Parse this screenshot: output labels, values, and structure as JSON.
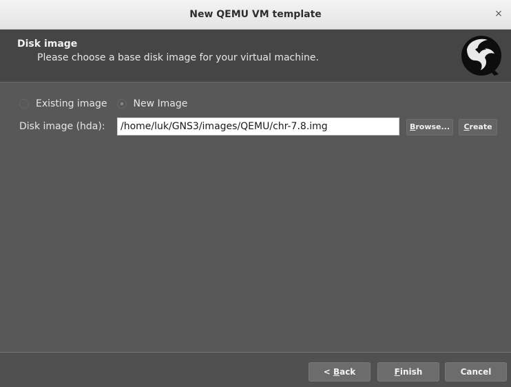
{
  "window": {
    "title": "New QEMU VM template",
    "close_glyph": "×"
  },
  "header": {
    "title": "Disk image",
    "subtitle": "Please choose a base disk image for your virtual machine.",
    "logo_icon": "qemu-logo"
  },
  "source": {
    "options": [
      {
        "label": "Existing image",
        "checked": false
      },
      {
        "label": "New Image",
        "checked": true
      }
    ]
  },
  "disk": {
    "label": "Disk image (hda):",
    "value": "/home/luk/GNS3/images/QEMU/chr-7.8.img",
    "browse_mnemonic": "B",
    "browse_rest": "rowse...",
    "create_mnemonic": "C",
    "create_rest": "reate"
  },
  "footer": {
    "back_prefix": "< ",
    "back_mnemonic": "B",
    "back_rest": "ack",
    "finish_mnemonic": "F",
    "finish_rest": "inish",
    "cancel_label": "Cancel"
  },
  "colors": {
    "titlebar": "#ececec",
    "header_bg": "#454545",
    "content_bg": "#585858",
    "input_bg": "#ffffff"
  }
}
